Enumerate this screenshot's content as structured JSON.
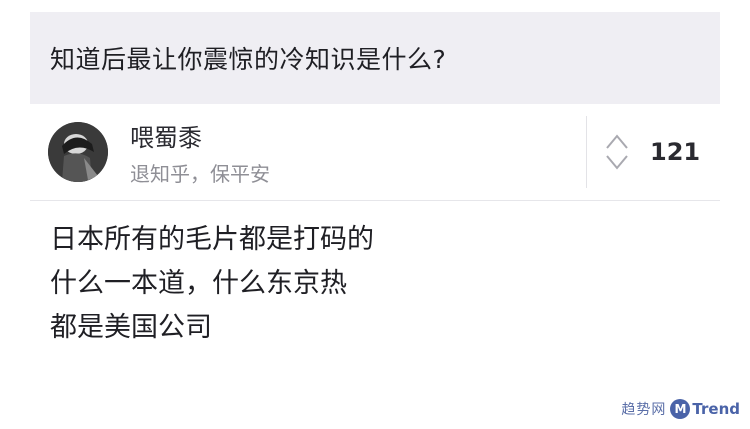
{
  "question": {
    "title": "知道后最让你震惊的冷知识是什么?"
  },
  "answer": {
    "author_name": "喂蜀黍",
    "author_bio": "退知乎，保平安",
    "vote_count": "121",
    "lines": [
      "日本所有的毛片都是打码的",
      "什么一本道，什么东京热",
      "都是美国公司"
    ]
  },
  "watermark": {
    "cn": "趋势网",
    "logo": "M",
    "en": "Trend"
  },
  "icons": {
    "vote": "up-down-vote-icon",
    "avatar": "user-avatar"
  },
  "colors": {
    "question_bg": "#efeef3",
    "text": "#1f1f24",
    "muted": "#8f8f96",
    "watermark": "#4a63a8"
  }
}
